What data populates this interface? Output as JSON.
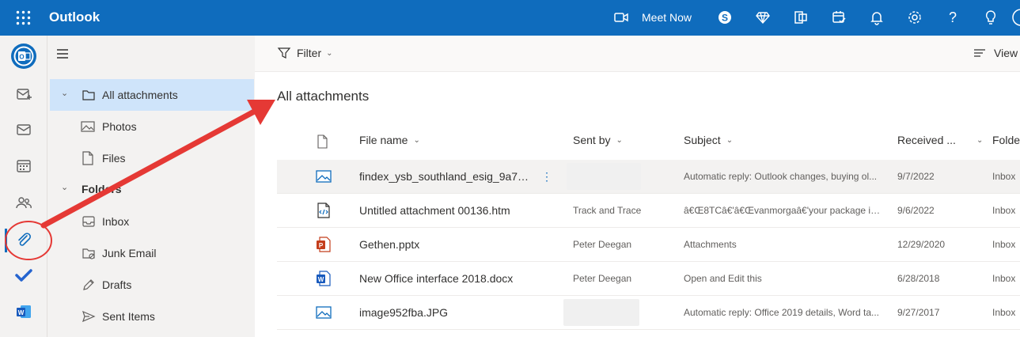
{
  "app": {
    "name": "Outlook"
  },
  "topbar": {
    "meet_now": "Meet Now"
  },
  "commands": {
    "filter": "Filter",
    "view": "View"
  },
  "nav": {
    "items": [
      {
        "label": "All attachments"
      },
      {
        "label": "Photos"
      },
      {
        "label": "Files"
      },
      {
        "label": "Folders"
      },
      {
        "label": "Inbox"
      },
      {
        "label": "Junk Email"
      },
      {
        "label": "Drafts"
      },
      {
        "label": "Sent Items"
      }
    ]
  },
  "main": {
    "title": "All attachments"
  },
  "table": {
    "columns": {
      "file_name": "File name",
      "sent_by": "Sent by",
      "subject": "Subject",
      "received": "Received ...",
      "folder": "Folde"
    },
    "rows": [
      {
        "file": "findex_ysb_southland_esig_9a753...",
        "sender": "",
        "subject": "Automatic reply: Outlook changes, buying ol...",
        "date": "9/7/2022",
        "folder": "Inbox",
        "icon": "image-file-icon"
      },
      {
        "file": "Untitled attachment 00136.htm",
        "sender": "Track and Trace",
        "subject": "â€Œ8TCâ€'â€Œvanmorgaâ€'your package is o...",
        "date": "9/6/2022",
        "folder": "Inbox",
        "icon": "html-file-icon"
      },
      {
        "file": "Gethen.pptx",
        "sender": "Peter Deegan",
        "subject": "Attachments",
        "date": "12/29/2020",
        "folder": "Inbox",
        "icon": "powerpoint-file-icon"
      },
      {
        "file": "New Office interface 2018.docx",
        "sender": "Peter Deegan",
        "subject": "Open and Edit this",
        "date": "6/28/2018",
        "folder": "Inbox",
        "icon": "word-file-icon"
      },
      {
        "file": "image952fba.JPG",
        "sender": "",
        "subject": "Automatic reply: Office 2019 details, Word ta...",
        "date": "9/27/2017",
        "folder": "Inbox",
        "icon": "image-file-icon"
      }
    ]
  },
  "colors": {
    "brand": "#0f6cbd",
    "selected": "#cfe4fa",
    "annotation": "#e53935"
  }
}
